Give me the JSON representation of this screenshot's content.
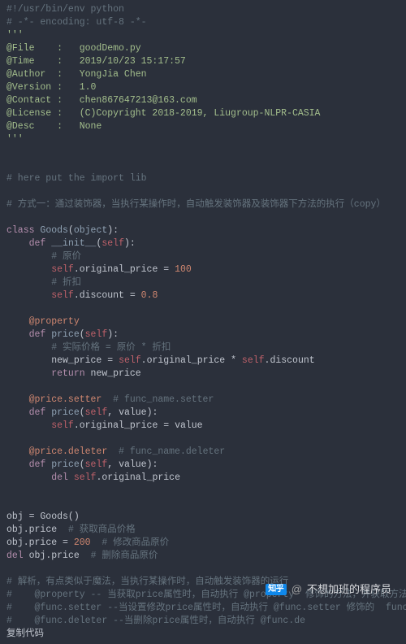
{
  "code": {
    "l01a": "#!/usr/bin/env python",
    "l01b": "# -*- encoding: utf-8 -*-",
    "l01c": "'''",
    "l02": "@File    :   goodDemo.py",
    "l03": "@Time    :   2019/10/23 15:17:57",
    "l04": "@Author  :   YongJia Chen ",
    "l05": "@Version :   1.0",
    "l06": "@Contact :   chen867647213@163.com",
    "l07": "@License :   (C)Copyright 2018-2019, Liugroup-NLPR-CASIA",
    "l08": "@Desc    :   None",
    "l08b": "'''",
    "l10": "# here put the import lib",
    "l12": "# 方式一：通过装饰器，当执行某操作时，自动触发装饰器及装饰器下方法的执行（copy）",
    "cls_kw": "class",
    "cls_name": "Goods",
    "cls_obj": "object",
    "def_kw": "def",
    "init_name": "__init__",
    "self_kw": "self",
    "c_orig": "# 原价",
    "orig_attr": "original_price",
    "orig_val": "100",
    "c_disc": "# 折扣",
    "disc_attr": "discount",
    "disc_val": "0.8",
    "dec_prop": "@property",
    "price_name": "price",
    "c_actual": "# 实际价格 = 原价 * 折扣",
    "new_price": "new_price",
    "ret_kw": "return",
    "dec_setter": "@price.setter",
    "c_setter": "# func_name.setter",
    "value_kw": "value",
    "dec_deleter": "@price.deleter",
    "c_deleter": "# func_name.deleter",
    "del_kw": "del",
    "obj_line": "obj = Goods()",
    "c_get": "# 获取商品价格",
    "set_val": "200",
    "c_set": "# 修改商品原价",
    "c_del": "# 删除商品原价",
    "c_expl1": "# 解析，有点类似于魔法，当执行某操作时，自动触发装饰器的运行",
    "c_expl2": "#    @property -- 当获取price属性时，自动执行 @property  修饰的方法，并获取方法的返回值，例如",
    "c_expl3": "#    @func.setter --当设置修改price属性时，自动执行 @func.setter 修饰的  func 方法，并将值赋",
    "c_expl4": "#    @func.deleter --当删除price属性时，自动执行 @func.de",
    "copy": "复制代码"
  },
  "watermark": {
    "logo": "知乎",
    "at": "@",
    "name": "不想加班的程序员"
  }
}
